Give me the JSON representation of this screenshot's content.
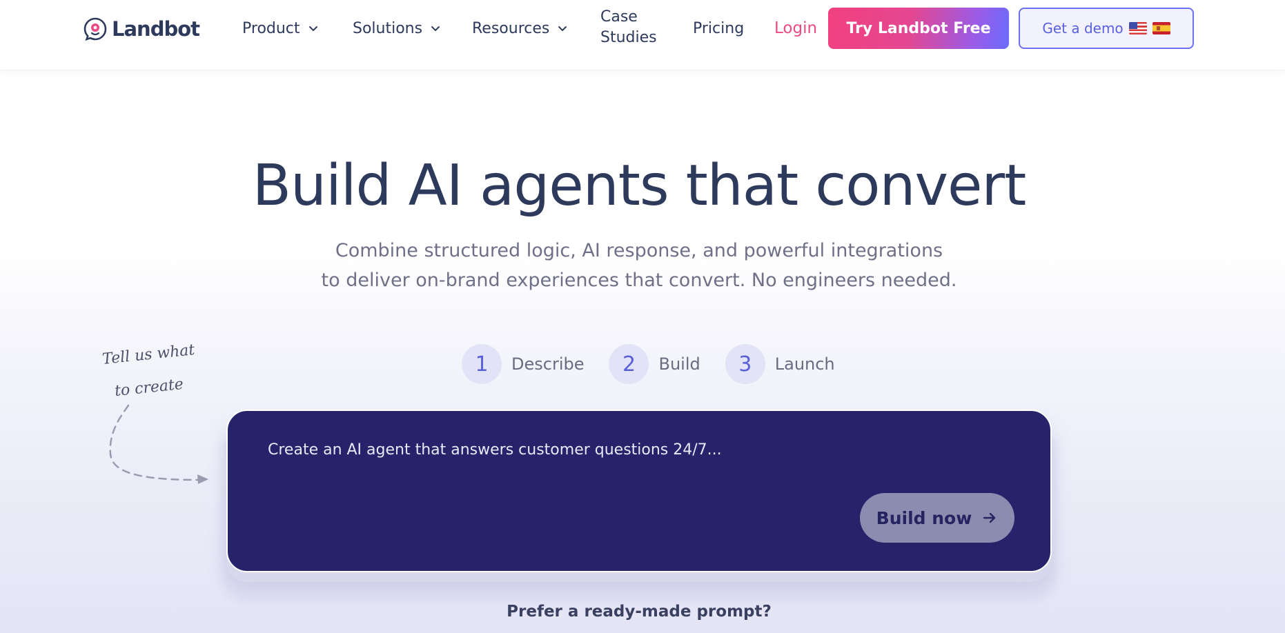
{
  "header": {
    "logo_text": "Landbot",
    "nav": [
      {
        "label": "Product",
        "has_dropdown": true
      },
      {
        "label": "Solutions",
        "has_dropdown": true
      },
      {
        "label": "Resources",
        "has_dropdown": true
      }
    ],
    "case_studies_line1": "Case",
    "case_studies_line2": "Studies",
    "pricing": "Pricing",
    "login": "Login",
    "try_button": "Try Landbot Free",
    "demo_button": "Get a demo",
    "flags": [
      "flag-us-icon",
      "flag-es-icon"
    ]
  },
  "hero": {
    "title": "Build AI agents that convert",
    "subtitle_line1": "Combine structured logic, AI response, and powerful integrations",
    "subtitle_line2": "to deliver on-brand experiences that convert. No engineers needed."
  },
  "steps": [
    {
      "number": "1",
      "label": "Describe"
    },
    {
      "number": "2",
      "label": "Build"
    },
    {
      "number": "3",
      "label": "Launch"
    }
  ],
  "hand_note": {
    "line1": "Tell us what",
    "line2": "to create"
  },
  "prompt": {
    "placeholder": "Create an AI agent that answers customer questions 24/7...",
    "build_button": "Build now"
  },
  "ready_made": "Prefer a ready-made prompt?",
  "colors": {
    "primary_text": "#2e3a5c",
    "login_pink": "#ec4a84",
    "prompt_bg": "#26236a",
    "accent_blue": "#5a5fe0"
  }
}
